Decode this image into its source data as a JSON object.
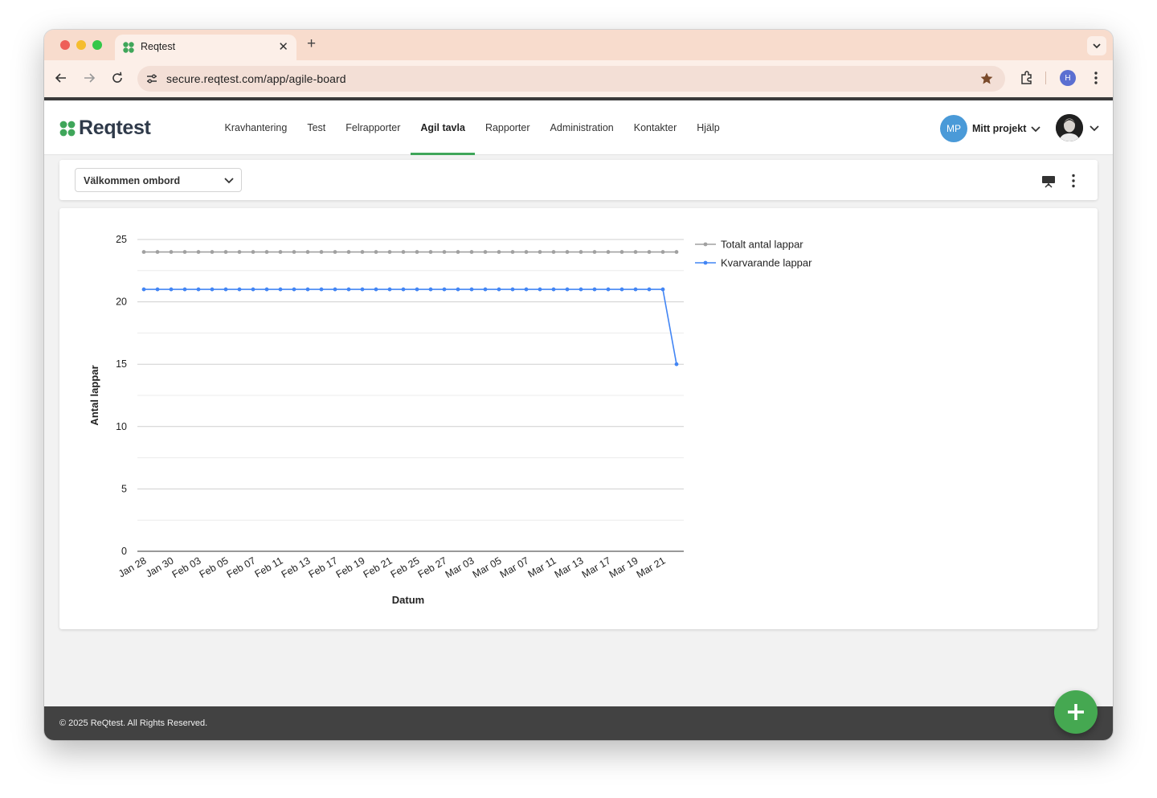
{
  "browser": {
    "tab_title": "Reqtest",
    "url": "secure.reqtest.com/app/agile-board",
    "profile_initial": "H"
  },
  "app": {
    "logo_text": "Reqtest",
    "nav": [
      {
        "label": "Kravhantering",
        "active": false
      },
      {
        "label": "Test",
        "active": false
      },
      {
        "label": "Felrapporter",
        "active": false
      },
      {
        "label": "Agil tavla",
        "active": true
      },
      {
        "label": "Rapporter",
        "active": false
      },
      {
        "label": "Administration",
        "active": false
      },
      {
        "label": "Kontakter",
        "active": false
      },
      {
        "label": "Hjälp",
        "active": false
      }
    ],
    "project": {
      "initials": "MP",
      "label": "Mitt projekt"
    }
  },
  "board": {
    "selected": "Välkommen ombord"
  },
  "chart_data": {
    "type": "line",
    "title": "",
    "xlabel": "Datum",
    "ylabel": "Antal lappar",
    "ylim": [
      0,
      25
    ],
    "yticks": [
      0,
      5,
      10,
      15,
      20,
      25
    ],
    "grid": true,
    "legend_position": "right",
    "x_tick_labels": [
      "Jan 28",
      "Jan 30",
      "Feb 03",
      "Feb 05",
      "Feb 07",
      "Feb 11",
      "Feb 13",
      "Feb 17",
      "Feb 19",
      "Feb 21",
      "Feb 25",
      "Feb 27",
      "Mar 03",
      "Mar 05",
      "Mar 07",
      "Mar 11",
      "Mar 13",
      "Mar 17",
      "Mar 19",
      "Mar 21"
    ],
    "x": [
      "Jan 28",
      "Jan 29",
      "Jan 30",
      "Jan 31",
      "Feb 03",
      "Feb 04",
      "Feb 05",
      "Feb 06",
      "Feb 07",
      "Feb 10",
      "Feb 11",
      "Feb 12",
      "Feb 13",
      "Feb 14",
      "Feb 17",
      "Feb 18",
      "Feb 19",
      "Feb 20",
      "Feb 21",
      "Feb 24",
      "Feb 25",
      "Feb 26",
      "Feb 27",
      "Feb 28",
      "Mar 03",
      "Mar 04",
      "Mar 05",
      "Mar 06",
      "Mar 07",
      "Mar 10",
      "Mar 11",
      "Mar 12",
      "Mar 13",
      "Mar 14",
      "Mar 17",
      "Mar 18",
      "Mar 19",
      "Mar 20",
      "Mar 21",
      "Mar 24"
    ],
    "series": [
      {
        "name": "Totalt antal lappar",
        "color": "#a0a0a0",
        "values": [
          24,
          24,
          24,
          24,
          24,
          24,
          24,
          24,
          24,
          24,
          24,
          24,
          24,
          24,
          24,
          24,
          24,
          24,
          24,
          24,
          24,
          24,
          24,
          24,
          24,
          24,
          24,
          24,
          24,
          24,
          24,
          24,
          24,
          24,
          24,
          24,
          24,
          24,
          24,
          24
        ]
      },
      {
        "name": "Kvarvarande lappar",
        "color": "#4285f4",
        "values": [
          21,
          21,
          21,
          21,
          21,
          21,
          21,
          21,
          21,
          21,
          21,
          21,
          21,
          21,
          21,
          21,
          21,
          21,
          21,
          21,
          21,
          21,
          21,
          21,
          21,
          21,
          21,
          21,
          21,
          21,
          21,
          21,
          21,
          21,
          21,
          21,
          21,
          21,
          21,
          15
        ]
      }
    ]
  },
  "footer": {
    "copyright": "© 2025 ReQtest. All Rights Reserved."
  }
}
